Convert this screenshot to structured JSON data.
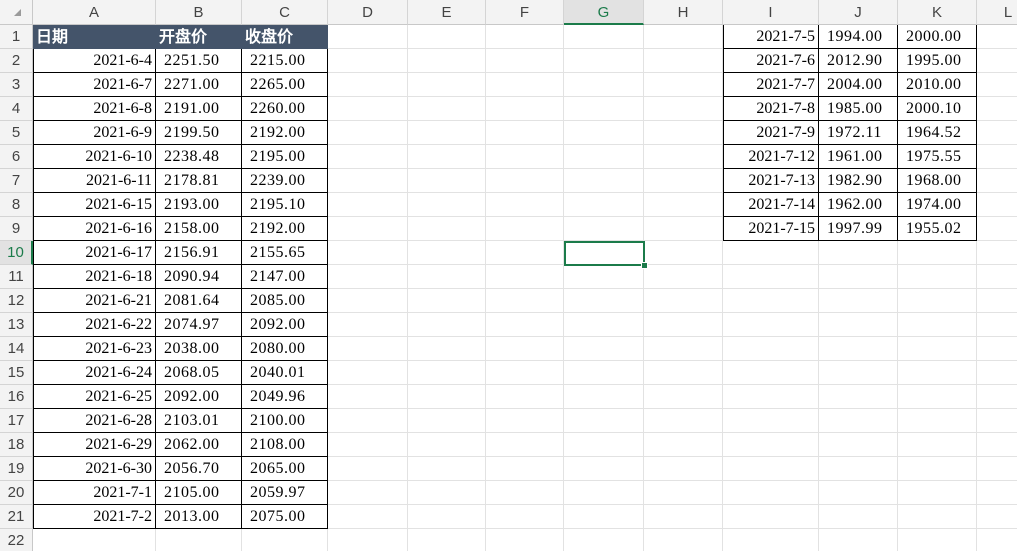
{
  "columns": [
    "A",
    "B",
    "C",
    "D",
    "E",
    "F",
    "G",
    "H",
    "I",
    "J",
    "K",
    "L"
  ],
  "rows": [
    "1",
    "2",
    "3",
    "4",
    "5",
    "6",
    "7",
    "8",
    "9",
    "10",
    "11",
    "12",
    "13",
    "14",
    "15",
    "16",
    "17",
    "18",
    "19",
    "20",
    "21",
    "22"
  ],
  "selected_cell": "G10",
  "selected_column": "G",
  "selected_row": "10",
  "colors": {
    "header_fill": "#44546a",
    "selection": "#1b7b4a"
  },
  "table_left": {
    "headers": [
      "日期",
      "开盘价",
      "收盘价"
    ],
    "rows": [
      [
        "2021-6-4",
        "2251.50",
        "2215.00"
      ],
      [
        "2021-6-7",
        "2271.00",
        "2265.00"
      ],
      [
        "2021-6-8",
        "2191.00",
        "2260.00"
      ],
      [
        "2021-6-9",
        "2199.50",
        "2192.00"
      ],
      [
        "2021-6-10",
        "2238.48",
        "2195.00"
      ],
      [
        "2021-6-11",
        "2178.81",
        "2239.00"
      ],
      [
        "2021-6-15",
        "2193.00",
        "2195.10"
      ],
      [
        "2021-6-16",
        "2158.00",
        "2192.00"
      ],
      [
        "2021-6-17",
        "2156.91",
        "2155.65"
      ],
      [
        "2021-6-18",
        "2090.94",
        "2147.00"
      ],
      [
        "2021-6-21",
        "2081.64",
        "2085.00"
      ],
      [
        "2021-6-22",
        "2074.97",
        "2092.00"
      ],
      [
        "2021-6-23",
        "2038.00",
        "2080.00"
      ],
      [
        "2021-6-24",
        "2068.05",
        "2040.01"
      ],
      [
        "2021-6-25",
        "2092.00",
        "2049.96"
      ],
      [
        "2021-6-28",
        "2103.01",
        "2100.00"
      ],
      [
        "2021-6-29",
        "2062.00",
        "2108.00"
      ],
      [
        "2021-6-30",
        "2056.70",
        "2065.00"
      ],
      [
        "2021-7-1",
        "2105.00",
        "2059.97"
      ],
      [
        "2021-7-2",
        "2013.00",
        "2075.00"
      ]
    ]
  },
  "table_right": {
    "rows": [
      [
        "2021-7-5",
        "1994.00",
        "2000.00"
      ],
      [
        "2021-7-6",
        "2012.90",
        "1995.00"
      ],
      [
        "2021-7-7",
        "2004.00",
        "2010.00"
      ],
      [
        "2021-7-8",
        "1985.00",
        "2000.10"
      ],
      [
        "2021-7-9",
        "1972.11",
        "1964.52"
      ],
      [
        "2021-7-12",
        "1961.00",
        "1975.55"
      ],
      [
        "2021-7-13",
        "1982.90",
        "1968.00"
      ],
      [
        "2021-7-14",
        "1962.00",
        "1974.00"
      ],
      [
        "2021-7-15",
        "1997.99",
        "1955.02"
      ]
    ]
  }
}
